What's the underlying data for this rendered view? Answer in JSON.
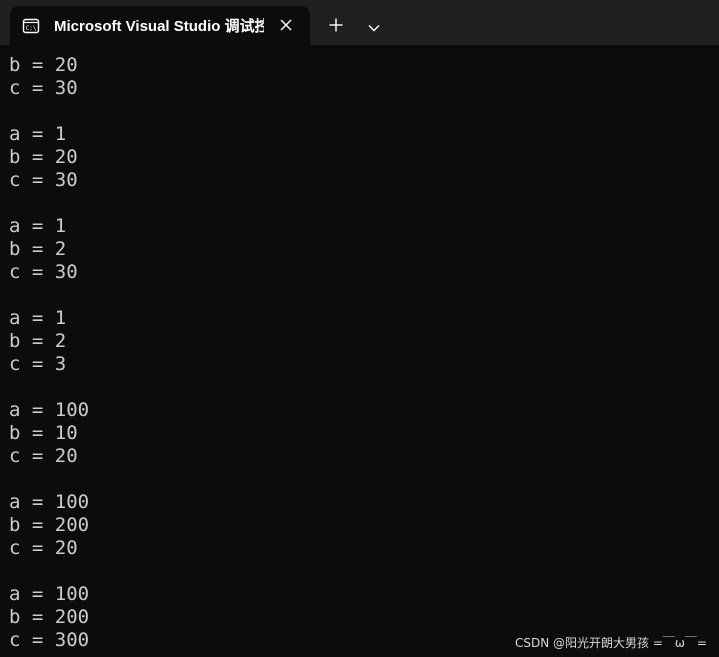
{
  "window": {
    "tab_title": "Microsoft Visual Studio 调试控制台",
    "tab_icon": "terminal-icon",
    "close_icon": "close-icon",
    "new_tab_icon": "plus-icon",
    "dropdown_icon": "chevron-down-icon"
  },
  "console": {
    "lines": [
      "b = 20",
      "c = 30",
      "",
      "a = 1",
      "b = 20",
      "c = 30",
      "",
      "a = 1",
      "b = 2",
      "c = 30",
      "",
      "a = 1",
      "b = 2",
      "c = 3",
      "",
      "a = 100",
      "b = 10",
      "c = 20",
      "",
      "a = 100",
      "b = 200",
      "c = 20",
      "",
      "a = 100",
      "b = 200",
      "c = 300"
    ]
  },
  "watermark": "CSDN @阳光开朗大男孩 =￣ω￣="
}
